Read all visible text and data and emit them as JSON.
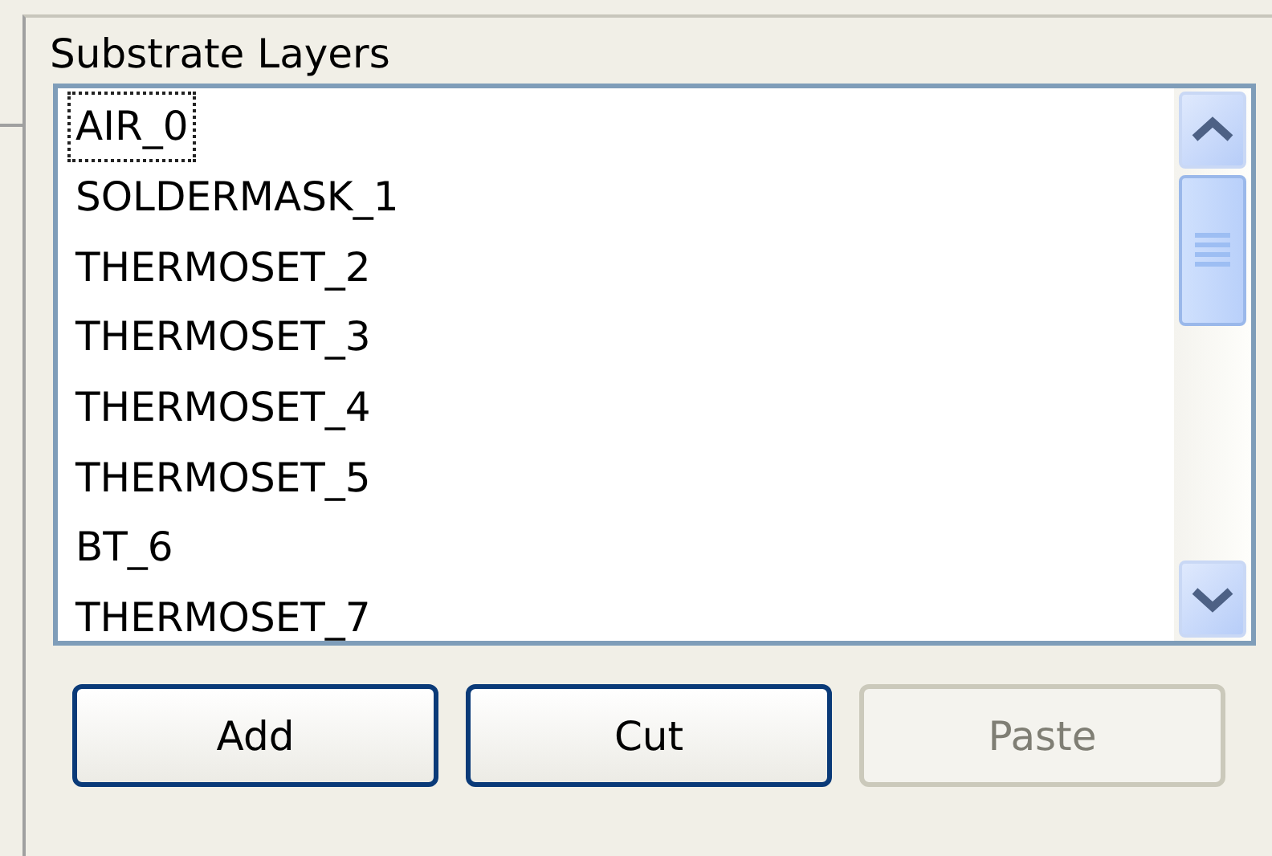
{
  "group": {
    "title": "Substrate Layers"
  },
  "layers": [
    {
      "label": "AIR_0",
      "focused": true
    },
    {
      "label": "SOLDERMASK_1",
      "focused": false
    },
    {
      "label": "THERMOSET_2",
      "focused": false
    },
    {
      "label": "THERMOSET_3",
      "focused": false
    },
    {
      "label": "THERMOSET_4",
      "focused": false
    },
    {
      "label": "THERMOSET_5",
      "focused": false
    },
    {
      "label": "BT_6",
      "focused": false
    },
    {
      "label": "THERMOSET_7",
      "focused": false
    }
  ],
  "buttons": [
    {
      "label": "Add",
      "disabled": false
    },
    {
      "label": "Cut",
      "disabled": false
    },
    {
      "label": "Paste",
      "disabled": true
    }
  ]
}
